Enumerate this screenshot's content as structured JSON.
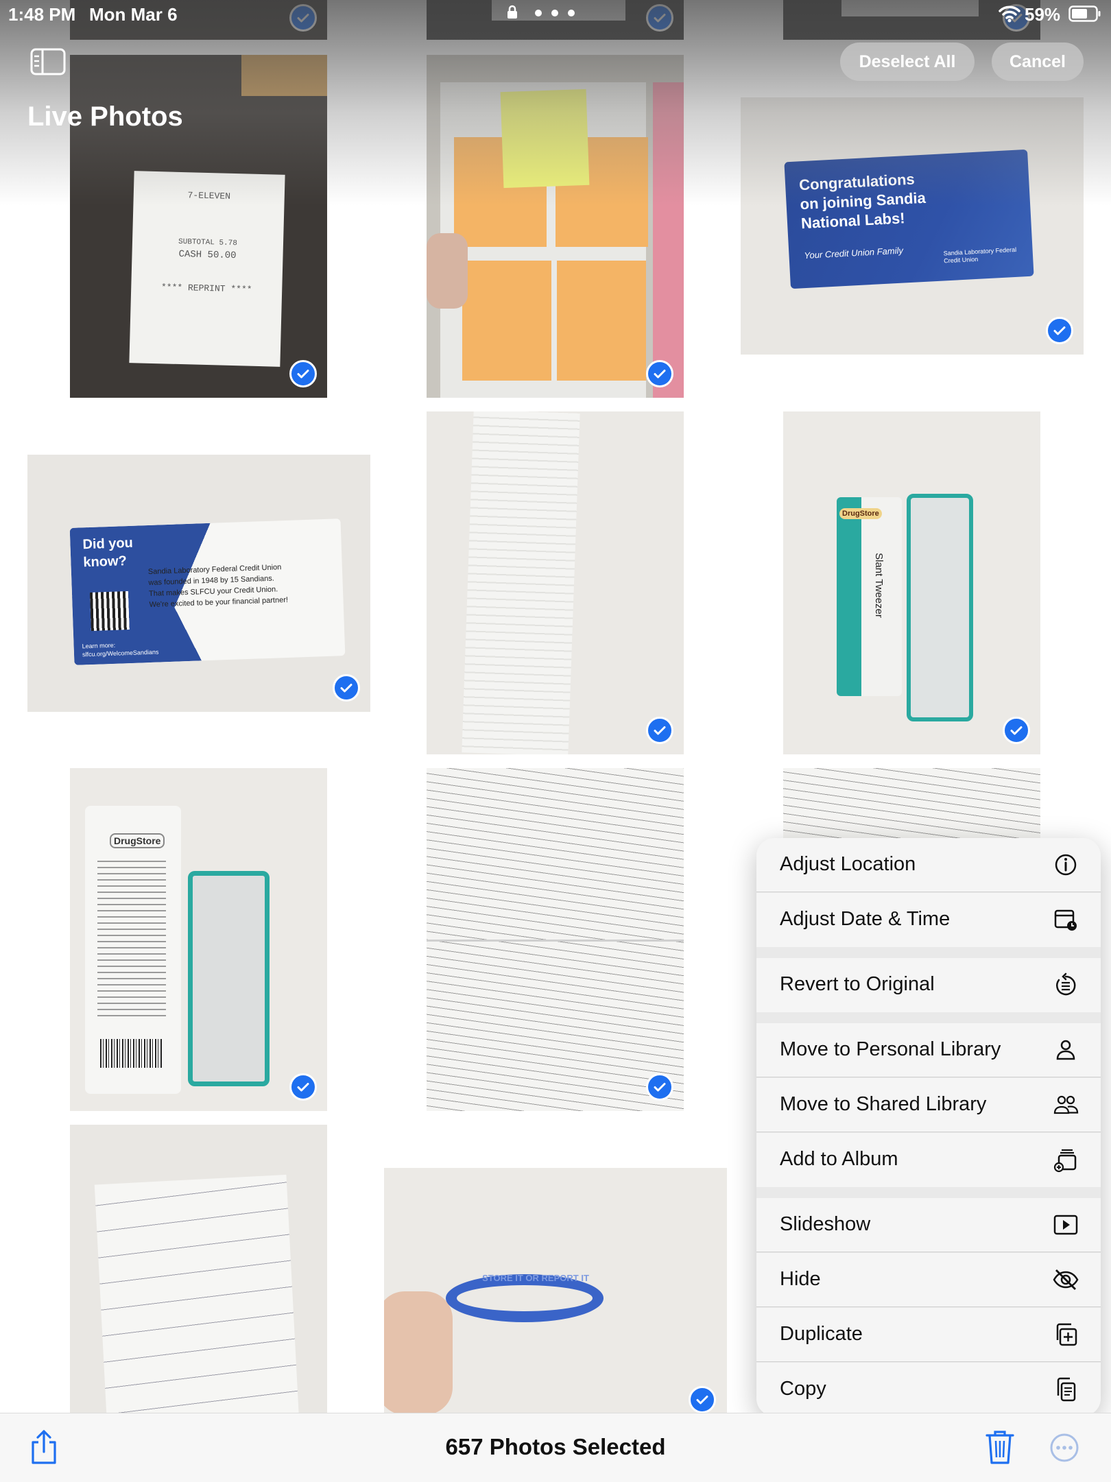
{
  "status_bar": {
    "time": "1:48 PM",
    "date": "Mon Mar 6",
    "battery": "59%"
  },
  "header": {
    "title": "Live Photos",
    "deselect_label": "Deselect All",
    "cancel_label": "Cancel"
  },
  "photos": [
    {
      "name": "receipt-7-eleven",
      "lines": [
        "7-ELEVEN",
        "SUBTOTAL 5.78",
        "CASH 50.00",
        "**** REPRINT ****"
      ]
    },
    {
      "name": "sticky-notes"
    },
    {
      "name": "slfcu-card-front",
      "lines": [
        "Congratulations",
        "on joining Sandia",
        "National Labs!",
        "Your Credit Union Family",
        "Sandia Laboratory Federal Credit Union"
      ]
    },
    {
      "name": "slfcu-card-back",
      "lines": [
        "Did you",
        "know?",
        "Sandia Laboratory Federal Credit Union",
        "was founded in 1948 by 15 Sandians.",
        "That makes SLFCU your Credit Union.",
        "We're excited to be your financial partner!",
        "Learn more:",
        "slfcu.org/WelcomeSandians"
      ]
    },
    {
      "name": "long-receipt"
    },
    {
      "name": "drugstore-tweezer-front",
      "lines": [
        "DrugStore",
        "Slant Tweezer"
      ]
    },
    {
      "name": "drugstore-tweezer-back",
      "lines": [
        "DrugStore"
      ]
    },
    {
      "name": "handwritten-notes"
    },
    {
      "name": "handwritten-notes-partial"
    },
    {
      "name": "handwritten-letter"
    },
    {
      "name": "blue-wristband",
      "lines": [
        "STORE IT OR REPORT IT"
      ]
    }
  ],
  "menu": {
    "items": [
      {
        "label": "Adjust Location",
        "icon": "info-location-icon"
      },
      {
        "label": "Adjust Date & Time",
        "icon": "calendar-clock-icon"
      },
      {
        "label": "Revert to Original",
        "icon": "revert-icon"
      },
      {
        "label": "Move to Personal Library",
        "icon": "person-icon"
      },
      {
        "label": "Move to Shared Library",
        "icon": "people-icon"
      },
      {
        "label": "Add to Album",
        "icon": "add-album-icon"
      },
      {
        "label": "Slideshow",
        "icon": "play-icon"
      },
      {
        "label": "Hide",
        "icon": "eye-slash-icon"
      },
      {
        "label": "Duplicate",
        "icon": "duplicate-icon"
      },
      {
        "label": "Copy",
        "icon": "copy-icon"
      }
    ]
  },
  "toolbar": {
    "selection_count": "657 Photos Selected"
  },
  "colors": {
    "accent": "#1e6ff0",
    "check": "#1e6ff0",
    "menu_bg": "#e8e8e8"
  }
}
